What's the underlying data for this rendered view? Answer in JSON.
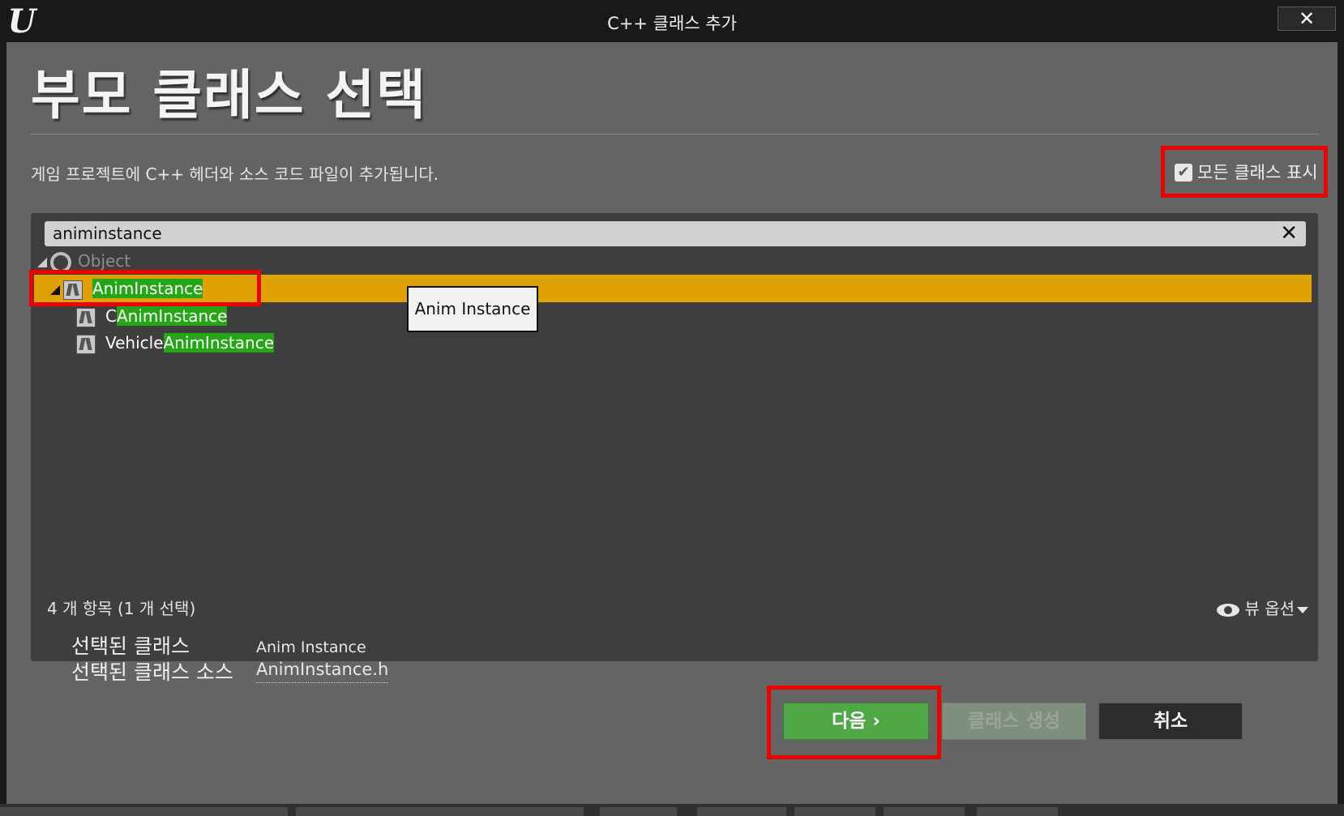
{
  "window": {
    "title": "C++ 클래스 추가",
    "logo_text": "U",
    "close_symbol": "✕"
  },
  "header": {
    "title": "부모 클래스 선택",
    "description": "게임 프로젝트에 C++ 헤더와 소스 코드 파일이 추가됩니다.",
    "show_all_checked": true,
    "show_all_check_glyph": "✔",
    "show_all_label": "모든 클래스 표시"
  },
  "search": {
    "value": "animinstance",
    "clear_symbol": "✕"
  },
  "tree": {
    "root": {
      "label": "Object",
      "icon": "circle-icon"
    },
    "selected": {
      "highlight": "AnimInstance",
      "icon": "anim-instance-icon"
    },
    "children": [
      {
        "prefix": "C",
        "highlight": "AnimInstance",
        "icon": "anim-instance-icon"
      },
      {
        "prefix": "Vehicle",
        "highlight": "AnimInstance",
        "icon": "anim-instance-icon"
      }
    ],
    "tooltip": "Anim Instance"
  },
  "status": {
    "count_text": "4 개 항목 (1 개 선택)",
    "view_options": "뷰 옵션"
  },
  "selection_info": {
    "class_label": "선택된 클래스",
    "class_value": "Anim Instance",
    "source_label": "선택된 클래스 소스",
    "source_value": "AnimInstance.h"
  },
  "buttons": {
    "next": "다음 ›",
    "create": "클래스 생성",
    "cancel": "취소"
  },
  "colors": {
    "selection_bar": "#e0a105",
    "match_highlight": "#25a616",
    "next_button": "#4fa845",
    "annotation_outline": "#ee0000"
  }
}
